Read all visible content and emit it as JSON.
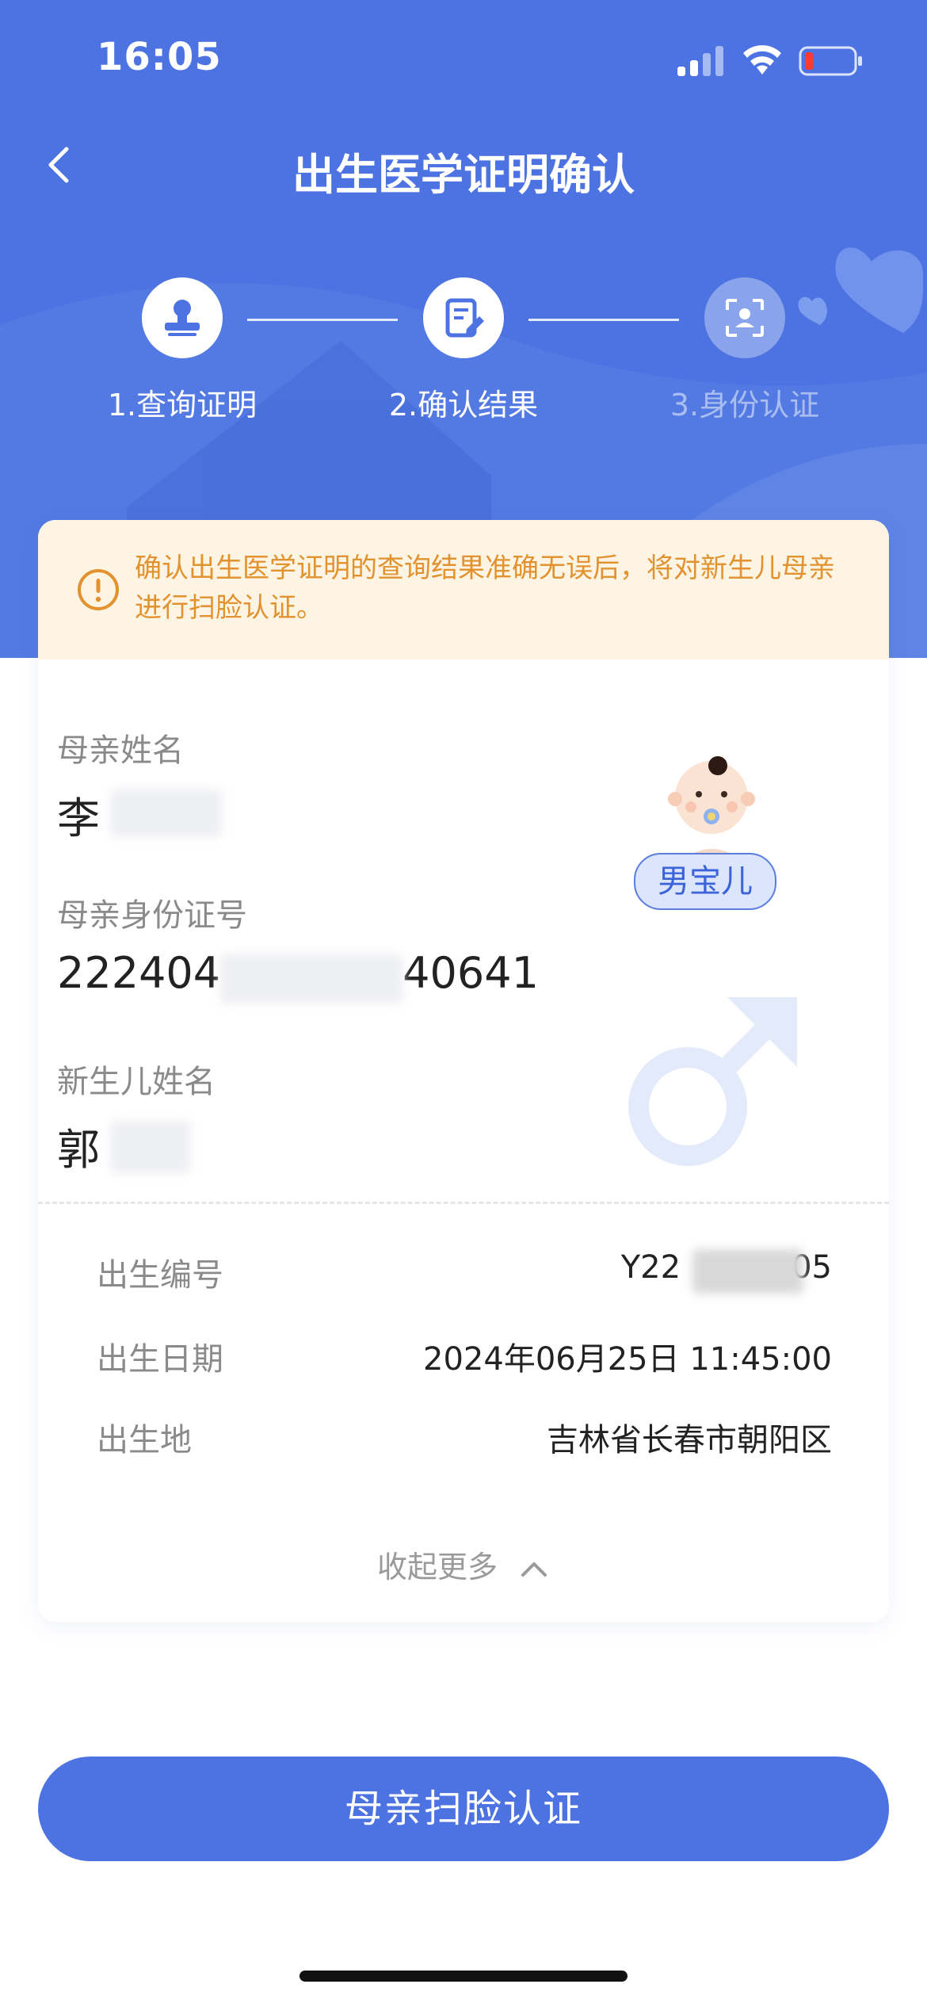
{
  "status_bar": {
    "time": "16:05"
  },
  "nav": {
    "title": "出生医学证明确认"
  },
  "steps": [
    {
      "label": "1.查询证明",
      "state": "done"
    },
    {
      "label": "2.确认结果",
      "state": "active"
    },
    {
      "label": "3.身份认证",
      "state": "inactive"
    }
  ],
  "notice": {
    "text": "确认出生医学证明的查询结果准确无误后，将对新生儿母亲进行扫脸认证。"
  },
  "mother": {
    "name_label": "母亲姓名",
    "name_value": "李",
    "id_label": "母亲身份证号",
    "id_value_prefix": "222404",
    "id_value_suffix": "40641"
  },
  "newborn": {
    "name_label": "新生儿姓名",
    "name_value": "郭",
    "gender_badge": "男宝儿"
  },
  "details": [
    {
      "label": "出生编号",
      "value_prefix": "Y22",
      "value_suffix": "05"
    },
    {
      "label": "出生日期",
      "value": "2024年06月25日 11:45:00"
    },
    {
      "label": "出生地",
      "value": "吉林省长春市朝阳区"
    }
  ],
  "collapse_label": "收起更多",
  "primary_button": "母亲扫脸认证",
  "colors": {
    "primary": "#4c73e1",
    "notice_text": "#e2922e",
    "notice_bg": "#fdf4e4"
  }
}
